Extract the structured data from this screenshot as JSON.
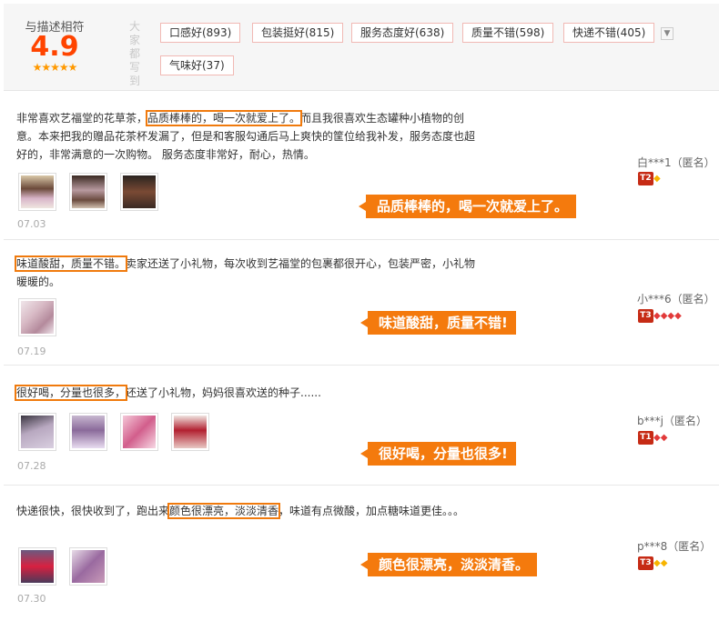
{
  "summary": {
    "label": "与描述相符",
    "score": "4.9",
    "stars": "★★★★★",
    "side_label": "大家都写到",
    "expand_icon": "chevron-down-icon",
    "tags": [
      {
        "text": "口感好(893)"
      },
      {
        "text": "包装挺好(815)"
      },
      {
        "text": "服务态度好(638)"
      },
      {
        "text": "质量不错(598)"
      },
      {
        "text": "快递不错(405)"
      },
      {
        "text": "气味好(37)"
      }
    ]
  },
  "reviews": [
    {
      "pre": "非常喜欢艺福堂的花草茶，",
      "highlight": "品质棒棒的，喝一次就爱上了。",
      "post": "而且我很喜欢生态罐种小植物的创意。本来把我的赠品花茶杯发漏了，但是和客服勾通后马上爽快的筐位给我补发，服务态度也超好的，非常满意的一次购物。 服务态度非常好，耐心，热情。",
      "date": "07.03",
      "user": "白***1（匿名）",
      "level": "T2",
      "callout": "品质棒棒的，喝一次就爱上了。"
    },
    {
      "pre": "",
      "highlight": "味道酸甜，质量不错。",
      "post": "卖家还送了小礼物，每次收到艺福堂的包裹都很开心，包装严密，小礼物暖暖的。",
      "date": "07.19",
      "user": "小***6（匿名）",
      "level": "T3",
      "callout": "味道酸甜，质量不错!"
    },
    {
      "pre": "",
      "highlight": "很好喝，分量也很多，",
      "post": "还送了小礼物，妈妈很喜欢送的种子......",
      "date": "07.28",
      "user": "b***j（匿名）",
      "level": "T1",
      "callout": "很好喝，分量也很多!"
    },
    {
      "pre": "快递很快，很快收到了，跑出来",
      "highlight": "颜色很漂亮，淡淡清香",
      "post": "，味道有点微酸，加点糖味道更佳。。。",
      "date": "07.30",
      "user": "p***8（匿名）",
      "level": "T3",
      "callout": "颜色很漂亮，淡淡清香。"
    }
  ],
  "colors": {
    "accent": "#f47a0d",
    "score": "#ff4400",
    "tag_border": "#f1b9b4",
    "level_badge": "#c62b15"
  },
  "icons": {
    "gem_yellow": "yellow-diamond-icon",
    "gem_red": "red-diamond-icon",
    "thumb": "review-photo-thumbnail"
  }
}
